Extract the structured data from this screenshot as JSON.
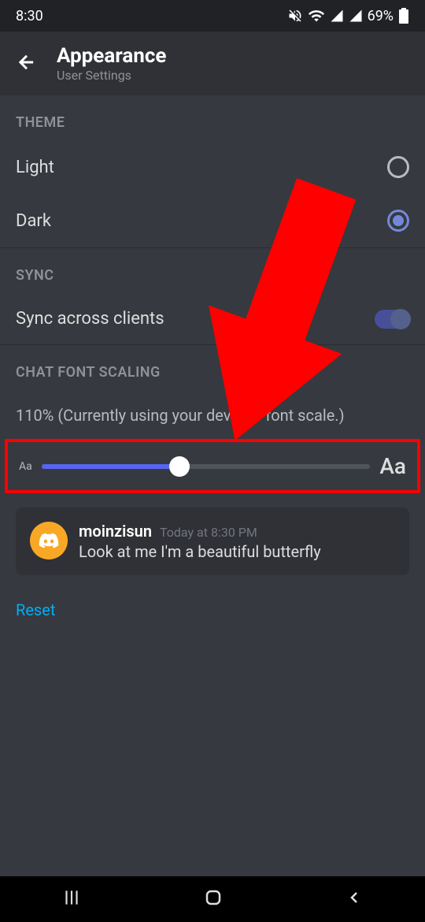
{
  "statusBar": {
    "time": "8:30",
    "battery": "69%"
  },
  "header": {
    "title": "Appearance",
    "subtitle": "User Settings"
  },
  "sections": {
    "theme": {
      "header": "THEME",
      "options": {
        "light": "Light",
        "dark": "Dark"
      }
    },
    "sync": {
      "header": "SYNC",
      "label": "Sync across clients"
    },
    "fontScaling": {
      "header": "CHAT FONT SCALING",
      "status": "110% (Currently using your device's font scale.)",
      "smallLabel": "Aa",
      "largeLabel": "Aa"
    }
  },
  "preview": {
    "username": "moinzisun",
    "timestamp": "Today at 8:30 PM",
    "message": "Look at me I'm a beautiful butterfly"
  },
  "reset": "Reset"
}
